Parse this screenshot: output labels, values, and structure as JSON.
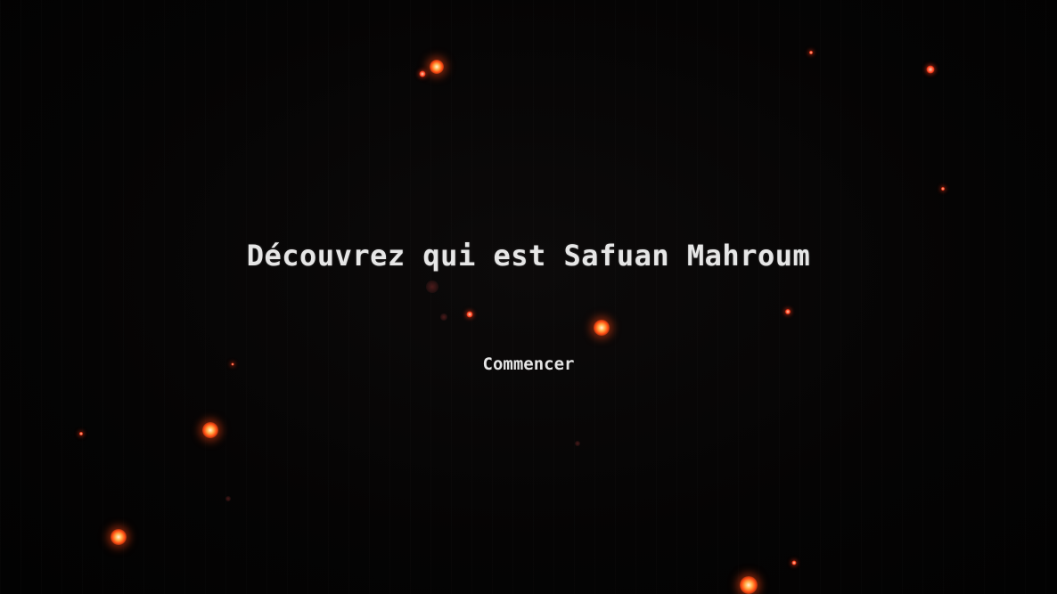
{
  "intro": {
    "headline": "Découvrez qui est Safuan Mahroum",
    "start_label": "Commencer"
  },
  "theme": {
    "background": "#050404",
    "ember_color": "#ff4a12",
    "text_color": "#e6e6e6"
  }
}
